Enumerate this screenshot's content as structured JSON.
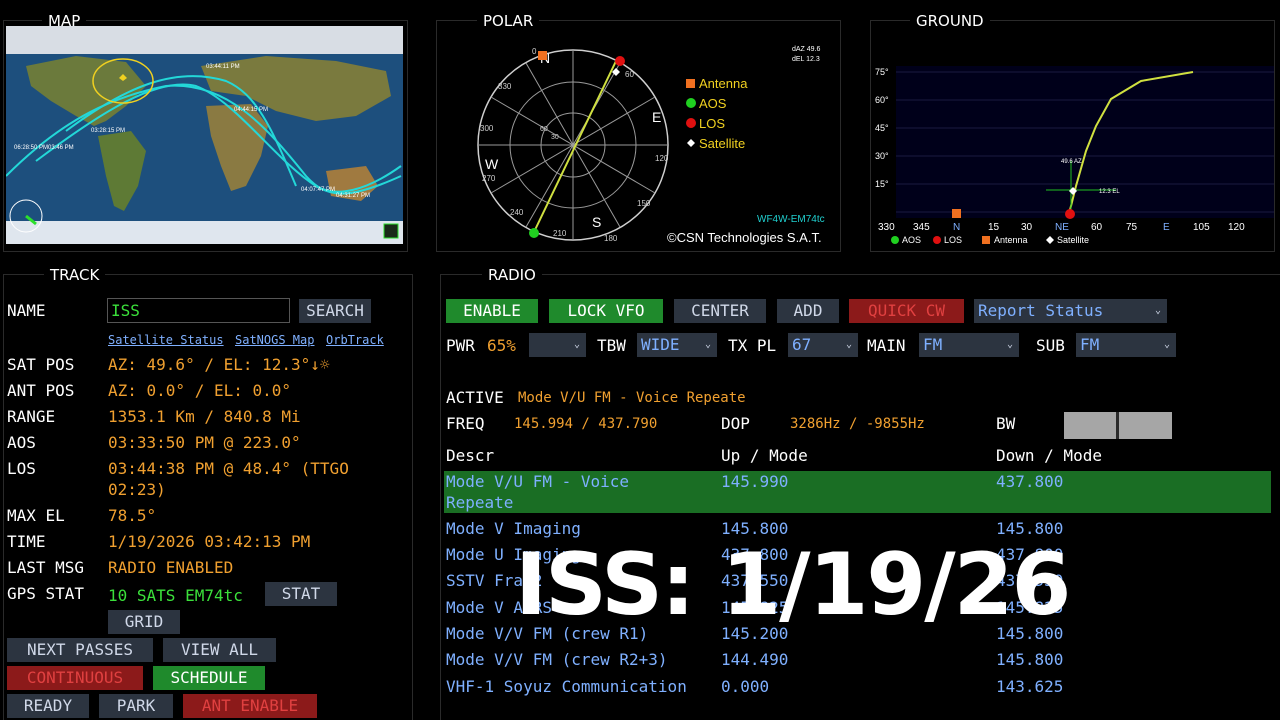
{
  "panels": {
    "map": "MAP",
    "polar": "POLAR",
    "ground": "GROUND",
    "track": "TRACK",
    "radio": "RADIO"
  },
  "map": {
    "labels": [
      "03:28:15 PM",
      "06:28:50 PM",
      "03:46 PM",
      "04:44:15 PM",
      "03:44:11 PM",
      "04:07:47 PM",
      "04:31:27 PM"
    ]
  },
  "polar": {
    "compass": {
      "n": "N",
      "e": "E",
      "s": "S",
      "w": "W"
    },
    "degrees": [
      "0",
      "330",
      "300",
      "270",
      "240",
      "210",
      "180",
      "150",
      "120",
      "60"
    ],
    "ring_labels": [
      "60",
      "30"
    ],
    "daz": "dAZ 49.6",
    "del": "dEL 12.3",
    "legend": [
      "Antenna",
      "AOS",
      "LOS",
      "Satellite"
    ],
    "callsign": "WF4W-EM74tc",
    "copyright": "©CSN Technologies S.A.T."
  },
  "ground": {
    "y_ticks": [
      "75°",
      "60°",
      "45°",
      "30°",
      "15°"
    ],
    "x_ticks": [
      "330",
      "345",
      "N",
      "15",
      "30",
      "NE",
      "60",
      "75",
      "E",
      "105",
      "120"
    ],
    "az_label": "49.6 AZ",
    "el_label": "12.3 EL",
    "legend": [
      "AOS",
      "LOS",
      "Antenna",
      "Satellite"
    ]
  },
  "track": {
    "name_label": "NAME",
    "name_value": "ISS",
    "search": "SEARCH",
    "links": [
      "Satellite Status",
      "SatNOGS Map",
      "OrbTrack"
    ],
    "rows": [
      {
        "label": "SAT POS",
        "value": "AZ: 49.6° / EL: 12.3°↓☼"
      },
      {
        "label": "ANT POS",
        "value": "AZ: 0.0° / EL: 0.0°"
      },
      {
        "label": "RANGE",
        "value": "1353.1 Km / 840.8 Mi"
      },
      {
        "label": "AOS",
        "value": "03:33:50 PM @ 223.0°"
      },
      {
        "label": "LOS",
        "value": "03:44:38 PM @ 48.4° (TTGO"
      },
      {
        "label": "",
        "value": "02:23)"
      },
      {
        "label": "MAX EL",
        "value": "78.5°"
      },
      {
        "label": "TIME",
        "value": "1/19/2026 03:42:13 PM"
      },
      {
        "label": "LAST MSG",
        "value": "RADIO ENABLED"
      }
    ],
    "gps_label": "GPS STAT",
    "gps_value": "10 SATS EM74tc",
    "stat": "STAT",
    "grid": "GRID",
    "buttons": {
      "next_passes": "NEXT PASSES",
      "view_all": "VIEW ALL",
      "continuous": "CONTINUOUS",
      "schedule": "SCHEDULE",
      "ready": "READY",
      "park": "PARK",
      "ant_enable": "ANT ENABLE"
    }
  },
  "radio": {
    "buttons": {
      "enable": "ENABLE",
      "lock_vfo": "LOCK VFO",
      "center": "CENTER",
      "add": "ADD",
      "quick_cw": "QUICK CW"
    },
    "report_select": "Report Status",
    "pwr_label": "PWR",
    "pwr_value": "65%",
    "tbw_label": "TBW",
    "tbw_value": "WIDE",
    "txpl_label": "TX PL",
    "txpl_value": "67",
    "main_label": "MAIN",
    "main_value": "FM",
    "sub_label": "SUB",
    "sub_value": "FM",
    "active_label": "ACTIVE",
    "active_value": "Mode V/U FM - Voice Repeate",
    "freq_label": "FREQ",
    "freq_value": "145.994 / 437.790",
    "dop_label": "DOP",
    "dop_value": "3286Hz / -9855Hz",
    "bw_label": "BW",
    "columns": [
      "Descr",
      "Up / Mode",
      "Down / Mode"
    ],
    "modes": [
      {
        "descr": "Mode V/U FM - Voice",
        "descr2": "Repeate",
        "up": "145.990",
        "down": "437.800"
      },
      {
        "descr": "Mode V Imaging",
        "up": "145.800",
        "down": "145.800"
      },
      {
        "descr": "Mode U Imaging",
        "up": "437.800",
        "down": "437.800"
      },
      {
        "descr": "SSTV Fram2",
        "up": "437.550",
        "down": "437.550"
      },
      {
        "descr": "Mode V APRS",
        "up": "145.825",
        "down": "145.825"
      },
      {
        "descr": "Mode V/V FM (crew R1)",
        "up": "145.200",
        "down": "145.800"
      },
      {
        "descr": "Mode V/V FM (crew R2+3)",
        "up": "144.490",
        "down": "145.800"
      },
      {
        "descr": "VHF-1 Soyuz Communication",
        "up": "0.000",
        "down": "143.625"
      }
    ]
  },
  "overlay": "ISS: 1/19/26"
}
